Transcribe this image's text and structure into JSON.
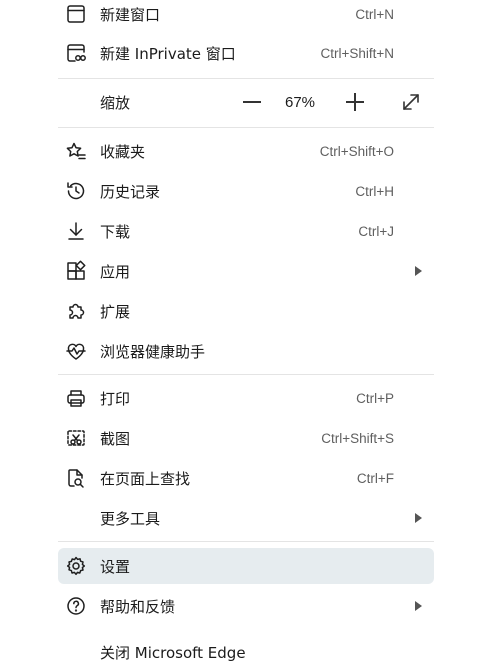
{
  "menu": {
    "new_window": {
      "label": "新建窗口",
      "shortcut": "Ctrl+N",
      "icon": "window-icon"
    },
    "new_inprivate": {
      "label": "新建 InPrivate 窗口",
      "shortcut": "Ctrl+Shift+N",
      "icon": "inprivate-window-icon"
    },
    "zoom": {
      "label": "缩放",
      "value": "67%",
      "minus_icon": "minus-icon",
      "plus_icon": "plus-icon",
      "fullscreen_icon": "fullscreen-icon"
    },
    "favorites": {
      "label": "收藏夹",
      "shortcut": "Ctrl+Shift+O",
      "icon": "favorites-icon"
    },
    "history": {
      "label": "历史记录",
      "shortcut": "Ctrl+H",
      "icon": "history-icon"
    },
    "downloads": {
      "label": "下载",
      "shortcut": "Ctrl+J",
      "icon": "download-icon"
    },
    "apps": {
      "label": "应用",
      "icon": "apps-icon",
      "has_submenu": true
    },
    "extensions": {
      "label": "扩展",
      "icon": "puzzle-icon"
    },
    "browser_health": {
      "label": "浏览器健康助手",
      "icon": "heart-pulse-icon"
    },
    "print": {
      "label": "打印",
      "shortcut": "Ctrl+P",
      "icon": "printer-icon"
    },
    "screenshot": {
      "label": "截图",
      "shortcut": "Ctrl+Shift+S",
      "icon": "screenshot-icon"
    },
    "find": {
      "label": "在页面上查找",
      "shortcut": "Ctrl+F",
      "icon": "find-in-page-icon"
    },
    "more_tools": {
      "label": "更多工具",
      "has_submenu": true
    },
    "settings": {
      "label": "设置",
      "icon": "gear-icon",
      "highlighted": true
    },
    "help": {
      "label": "帮助和反馈",
      "icon": "help-icon",
      "has_submenu": true
    },
    "close": {
      "label": "关闭 Microsoft Edge"
    }
  },
  "colors": {
    "highlight": "#e6ecef",
    "text": "#1b1b1b",
    "shortcut": "#5f5f5f"
  }
}
